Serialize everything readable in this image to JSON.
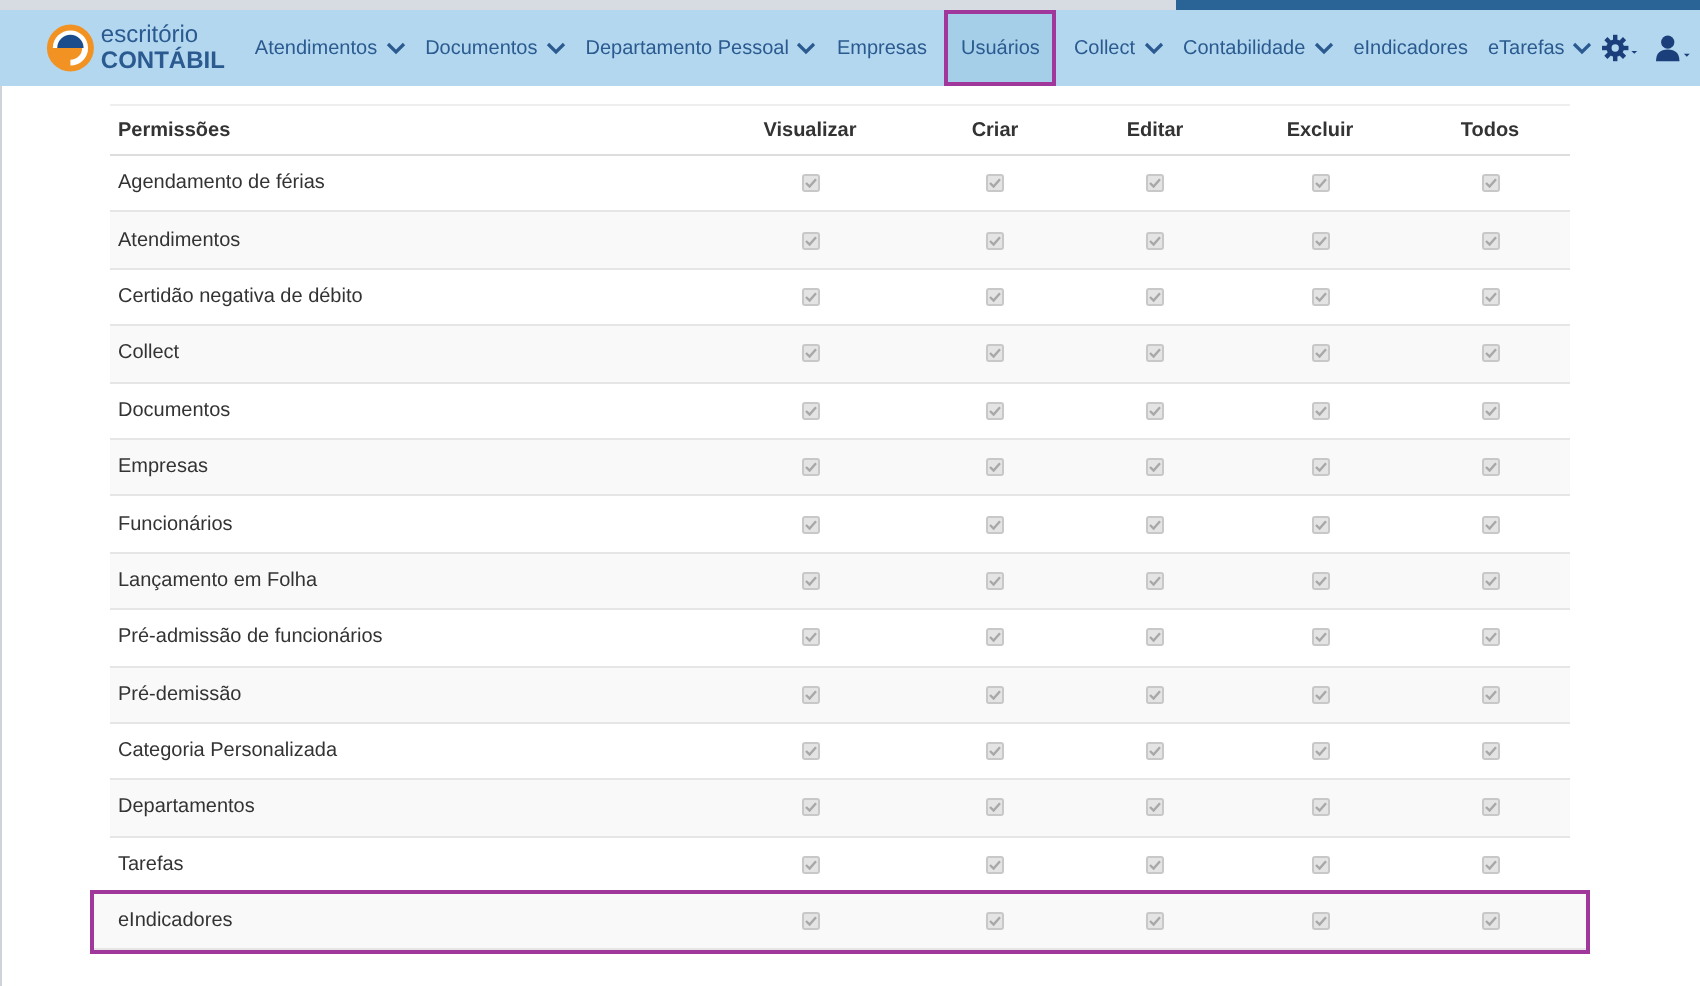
{
  "logo": {
    "line_1": "escritório",
    "line_2": "CONTÁBIL"
  },
  "nav": [
    {
      "label": "Atendimentos",
      "dropdown": true,
      "selected": false
    },
    {
      "label": "Documentos",
      "dropdown": true,
      "selected": false
    },
    {
      "label": "Departamento Pessoal",
      "dropdown": true,
      "selected": false
    },
    {
      "label": "Empresas",
      "dropdown": false,
      "selected": false
    },
    {
      "label": "Usuários",
      "dropdown": false,
      "selected": true
    },
    {
      "label": "Collect",
      "dropdown": true,
      "selected": false
    },
    {
      "label": "Contabilidade",
      "dropdown": true,
      "selected": false
    },
    {
      "label": "eIndicadores",
      "dropdown": false,
      "selected": false
    },
    {
      "label": "eTarefas",
      "dropdown": true,
      "selected": false
    }
  ],
  "table": {
    "columns": [
      "Permissões",
      "Visualizar",
      "Criar",
      "Editar",
      "Excluir",
      "Todos"
    ],
    "rows": [
      {
        "label": "Agendamento de férias",
        "highlighted": false,
        "checks": [
          {
            "checked": true,
            "disabled": true
          },
          {
            "checked": true,
            "disabled": true
          },
          {
            "checked": true,
            "disabled": true
          },
          {
            "checked": true,
            "disabled": true
          },
          {
            "checked": true,
            "disabled": true
          }
        ]
      },
      {
        "label": "Atendimentos",
        "highlighted": false,
        "checks": [
          {
            "checked": true,
            "disabled": true
          },
          {
            "checked": true,
            "disabled": true
          },
          {
            "checked": true,
            "disabled": true
          },
          {
            "checked": true,
            "disabled": true
          },
          {
            "checked": true,
            "disabled": true
          }
        ]
      },
      {
        "label": "Certidão negativa de débito",
        "highlighted": false,
        "checks": [
          {
            "checked": true,
            "disabled": true
          },
          {
            "checked": true,
            "disabled": true
          },
          {
            "checked": true,
            "disabled": true
          },
          {
            "checked": true,
            "disabled": true
          },
          {
            "checked": true,
            "disabled": true
          }
        ]
      },
      {
        "label": "Collect",
        "highlighted": false,
        "checks": [
          {
            "checked": true,
            "disabled": true
          },
          {
            "checked": true,
            "disabled": true
          },
          {
            "checked": true,
            "disabled": true
          },
          {
            "checked": true,
            "disabled": true
          },
          {
            "checked": true,
            "disabled": true
          }
        ]
      },
      {
        "label": "Documentos",
        "highlighted": false,
        "checks": [
          {
            "checked": true,
            "disabled": true
          },
          {
            "checked": true,
            "disabled": true
          },
          {
            "checked": true,
            "disabled": true
          },
          {
            "checked": true,
            "disabled": true
          },
          {
            "checked": true,
            "disabled": true
          }
        ]
      },
      {
        "label": "Empresas",
        "highlighted": false,
        "checks": [
          {
            "checked": true,
            "disabled": true
          },
          {
            "checked": true,
            "disabled": true
          },
          {
            "checked": true,
            "disabled": true
          },
          {
            "checked": true,
            "disabled": true
          },
          {
            "checked": true,
            "disabled": true
          }
        ]
      },
      {
        "label": "Funcionários",
        "highlighted": false,
        "checks": [
          {
            "checked": true,
            "disabled": true
          },
          {
            "checked": true,
            "disabled": true
          },
          {
            "checked": true,
            "disabled": true
          },
          {
            "checked": true,
            "disabled": true
          },
          {
            "checked": true,
            "disabled": true
          }
        ]
      },
      {
        "label": "Lançamento em Folha",
        "highlighted": false,
        "checks": [
          {
            "checked": true,
            "disabled": true
          },
          {
            "checked": true,
            "disabled": true
          },
          {
            "checked": true,
            "disabled": true
          },
          {
            "checked": true,
            "disabled": true
          },
          {
            "checked": true,
            "disabled": true
          }
        ]
      },
      {
        "label": "Pré-admissão de funcionários",
        "highlighted": false,
        "checks": [
          {
            "checked": true,
            "disabled": true
          },
          {
            "checked": true,
            "disabled": true
          },
          {
            "checked": true,
            "disabled": true
          },
          {
            "checked": true,
            "disabled": true
          },
          {
            "checked": true,
            "disabled": true
          }
        ]
      },
      {
        "label": "Pré-demissão",
        "highlighted": false,
        "checks": [
          {
            "checked": true,
            "disabled": true
          },
          {
            "checked": true,
            "disabled": true
          },
          {
            "checked": true,
            "disabled": true
          },
          {
            "checked": true,
            "disabled": true
          },
          {
            "checked": true,
            "disabled": true
          }
        ]
      },
      {
        "label": "Categoria Personalizada",
        "highlighted": false,
        "checks": [
          {
            "checked": true,
            "disabled": true
          },
          {
            "checked": true,
            "disabled": true
          },
          {
            "checked": true,
            "disabled": true
          },
          {
            "checked": true,
            "disabled": true
          },
          {
            "checked": true,
            "disabled": true
          }
        ]
      },
      {
        "label": "Departamentos",
        "highlighted": false,
        "checks": [
          {
            "checked": true,
            "disabled": true
          },
          {
            "checked": true,
            "disabled": true
          },
          {
            "checked": true,
            "disabled": true
          },
          {
            "checked": true,
            "disabled": true
          },
          {
            "checked": true,
            "disabled": true
          }
        ]
      },
      {
        "label": "Tarefas",
        "highlighted": false,
        "checks": [
          {
            "checked": true,
            "disabled": true
          },
          {
            "checked": true,
            "disabled": true
          },
          {
            "checked": true,
            "disabled": true
          },
          {
            "checked": true,
            "disabled": true
          },
          {
            "checked": true,
            "disabled": true
          }
        ]
      },
      {
        "label": "eIndicadores",
        "highlighted": true,
        "checks": [
          {
            "checked": true,
            "disabled": true
          },
          {
            "checked": true,
            "disabled": true
          },
          {
            "checked": true,
            "disabled": true
          },
          {
            "checked": true,
            "disabled": true
          },
          {
            "checked": true,
            "disabled": true
          }
        ]
      }
    ]
  }
}
